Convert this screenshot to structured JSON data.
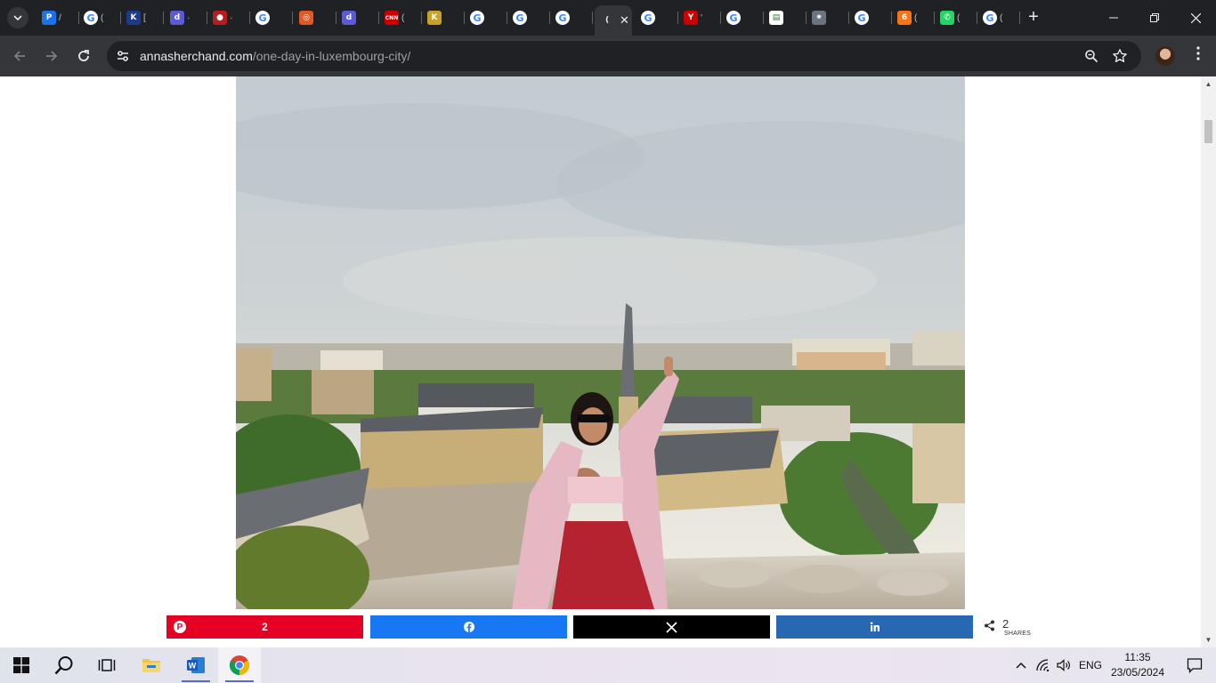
{
  "browser": {
    "tabs": [
      {
        "favicon": "p-icon",
        "glyph": "P",
        "color": "#1a73e8",
        "title_fragment": "/"
      },
      {
        "favicon": "google-icon",
        "glyph": "G",
        "color": "#ffffff",
        "title_fragment": "("
      },
      {
        "favicon": "k-flag-icon",
        "glyph": "K",
        "color": "#1e3a8a",
        "title_fragment": "["
      },
      {
        "favicon": "d-icon",
        "glyph": "d",
        "color": "#5b5bd6",
        "title_fragment": "·"
      },
      {
        "favicon": "basketball-icon",
        "glyph": "●",
        "color": "#b91c1c",
        "title_fragment": "·"
      },
      {
        "favicon": "google-icon",
        "glyph": "G",
        "color": "#ffffff",
        "title_fragment": ""
      },
      {
        "favicon": "chrome-store-icon",
        "glyph": "◎",
        "color": "#e25822",
        "title_fragment": ""
      },
      {
        "favicon": "d-icon",
        "glyph": "d",
        "color": "#5b5bd6",
        "title_fragment": ""
      },
      {
        "favicon": "cnn-icon",
        "glyph": "CNN",
        "color": "#cc0000",
        "title_fragment": "("
      },
      {
        "favicon": "k-badge-icon",
        "glyph": "K",
        "color": "#c9a227",
        "title_fragment": ""
      },
      {
        "favicon": "google-icon",
        "glyph": "G",
        "color": "#ffffff",
        "title_fragment": ""
      },
      {
        "favicon": "google-icon",
        "glyph": "G",
        "color": "#ffffff",
        "title_fragment": ""
      },
      {
        "favicon": "google-icon",
        "glyph": "G",
        "color": "#ffffff",
        "title_fragment": ""
      },
      {
        "favicon": "active-tab-icon",
        "glyph": "(",
        "color": "#35363a",
        "title_fragment": "",
        "active": true
      },
      {
        "favicon": "google-icon",
        "glyph": "G",
        "color": "#ffffff",
        "title_fragment": ""
      },
      {
        "favicon": "yb-icon",
        "glyph": "Y",
        "color": "#cc0000",
        "title_fragment": "'"
      },
      {
        "favicon": "google-icon",
        "glyph": "G",
        "color": "#ffffff",
        "title_fragment": ""
      },
      {
        "favicon": "news-icon",
        "glyph": "▤",
        "color": "#ffffff",
        "title_fragment": ""
      },
      {
        "favicon": "nbc-icon",
        "glyph": "✷",
        "color": "#6b7280",
        "title_fragment": ""
      },
      {
        "favicon": "google-icon",
        "glyph": "G",
        "color": "#ffffff",
        "title_fragment": ""
      },
      {
        "favicon": "six-icon",
        "glyph": "6",
        "color": "#f97316",
        "title_fragment": "("
      },
      {
        "favicon": "whatsapp-icon",
        "glyph": "✆",
        "color": "#25d366",
        "title_fragment": "("
      },
      {
        "favicon": "google-icon",
        "glyph": "G",
        "color": "#ffffff",
        "title_fragment": "("
      }
    ],
    "url_host": "annasherchand.com",
    "url_path": "/one-day-in-luxembourg-city/"
  },
  "share": {
    "pinterest_count": "2",
    "total_count": "2",
    "total_label": "SHARES",
    "colors": {
      "pinterest": "#e60023",
      "facebook": "#1877f2",
      "x": "#000000",
      "linkedin": "#2867b2"
    }
  },
  "taskbar": {
    "language": "ENG",
    "time": "11:35",
    "date": "23/05/2024"
  }
}
